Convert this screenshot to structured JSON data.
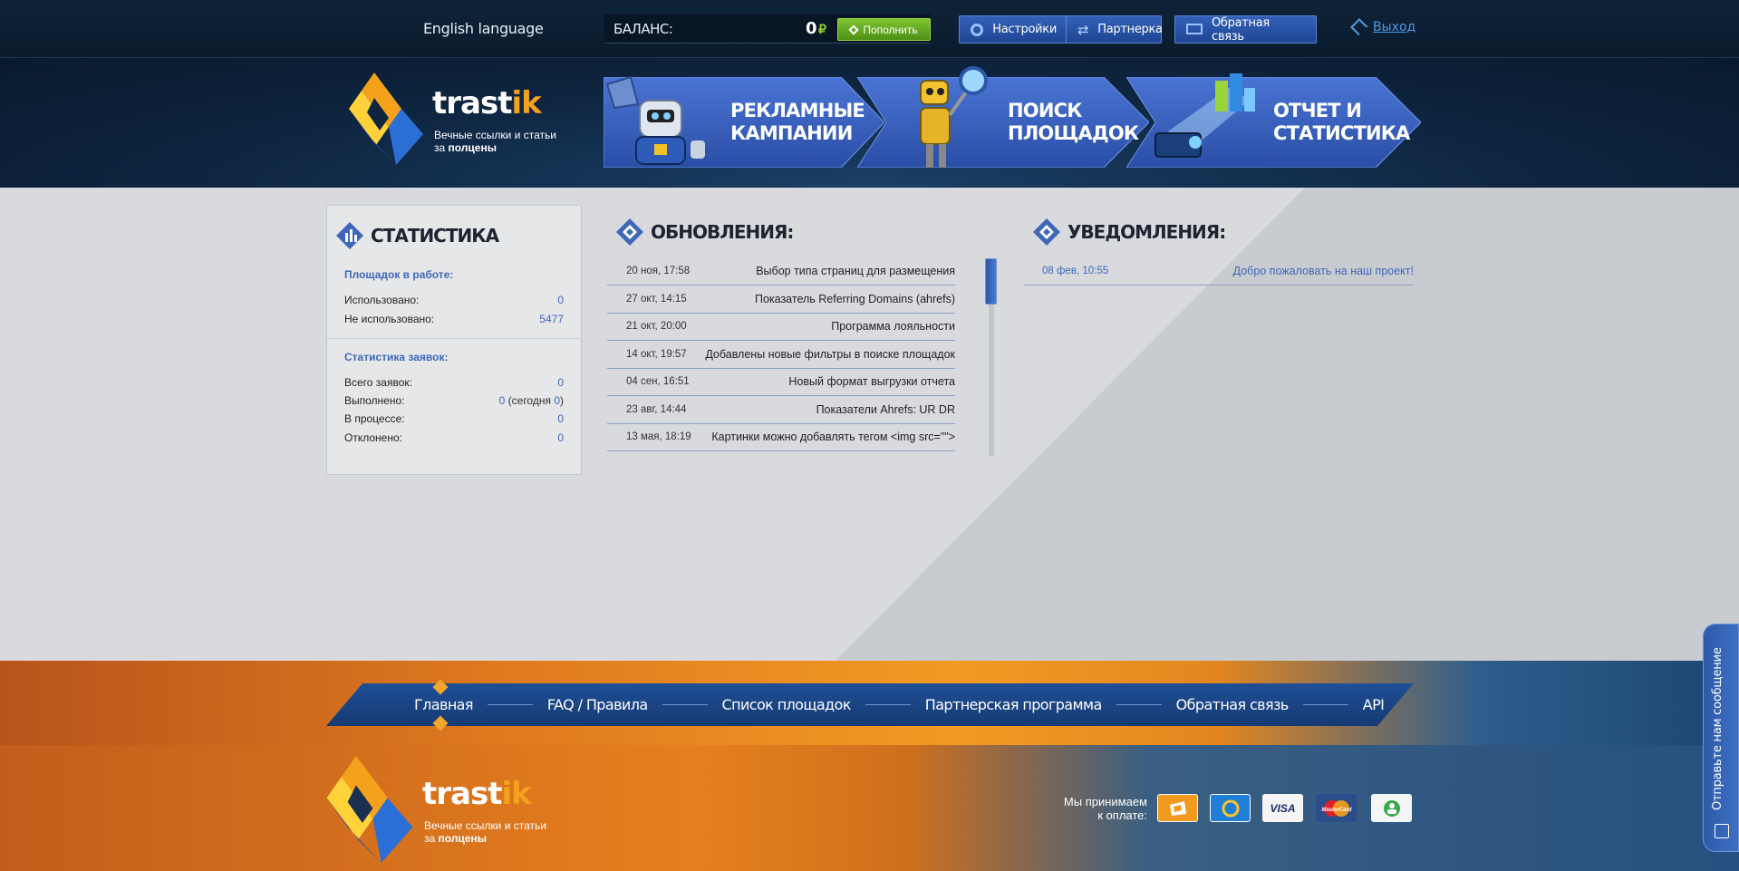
{
  "topbar": {
    "language": "English language",
    "balance_label": "БАЛАНС:",
    "balance_amount": "0",
    "currency": "₽",
    "topup_label": "Пополнить",
    "settings_label": "Настройки",
    "partner_label": "Партнерка",
    "feedback_label": "Обратная связь",
    "logout_label": "Выход"
  },
  "header": {
    "logo_text": "trast",
    "logo_text_accent": "ik",
    "tagline_1": "Вечные ссылки и статьи",
    "tagline_2a": "за ",
    "tagline_2b": "полцены",
    "banners": [
      {
        "line1": "РЕКЛАМНЫЕ",
        "line2": "КАМПАНИИ"
      },
      {
        "line1": "ПОИСК",
        "line2": "ПЛОЩАДОК"
      },
      {
        "line1": "ОТЧЕТ И",
        "line2": "СТАТИСТИКА"
      }
    ]
  },
  "stats": {
    "title": "СТАТИСТИКА",
    "sites_sub": "Площадок в работе:",
    "used_label": "Использовано:",
    "used_value": "0",
    "unused_label": "Не использовано:",
    "unused_value": "5477",
    "requests_sub": "Статистика заявок:",
    "total_label": "Всего заявок:",
    "total_value": "0",
    "done_label": "Выполнено:",
    "done_value": "0",
    "done_today_open": " (сегодня ",
    "done_today_value": "0",
    "done_today_close": ")",
    "progress_label": "В процессе:",
    "progress_value": "0",
    "rejected_label": "Отклонено:",
    "rejected_value": "0"
  },
  "updates": {
    "title": "ОБНОВЛЕНИЯ:",
    "items": [
      {
        "date": "20 ноя, 17:58",
        "text": "Выбор типа страниц для размещения"
      },
      {
        "date": "27 окт, 14:15",
        "text": "Показатель Referring Domains (ahrefs)"
      },
      {
        "date": "21 окт, 20:00",
        "text": "Программа лояльности"
      },
      {
        "date": "14 окт, 19:57",
        "text": "Добавлены новые фильтры в поиске площадок"
      },
      {
        "date": "04 сен, 16:51",
        "text": "Новый формат выгрузки отчета"
      },
      {
        "date": "23 авг, 14:44",
        "text": "Показатели Ahrefs: UR DR"
      },
      {
        "date": "13 мая, 18:19",
        "text": "Картинки можно добавлять тегом <img src=\"\">"
      }
    ]
  },
  "notifications": {
    "title": "УВЕДОМЛЕНИЯ:",
    "items": [
      {
        "date": "08 фев, 10:55",
        "text": "Добро пожаловать на наш проект!"
      }
    ]
  },
  "footer": {
    "nav": [
      "Главная",
      "FAQ / Правила",
      "Список площадок",
      "Партнерская программа",
      "Обратная связь",
      "API"
    ],
    "pay_label_1": "Мы принимаем",
    "pay_label_2": "к оплате:",
    "visa": "VISA",
    "mastercard": "MasterCard",
    "feedback_tab": "Отправьте нам сообщение"
  },
  "colors": {
    "accent_blue": "#3f67b9",
    "green": "#7ec430",
    "orange": "#f29a24"
  }
}
